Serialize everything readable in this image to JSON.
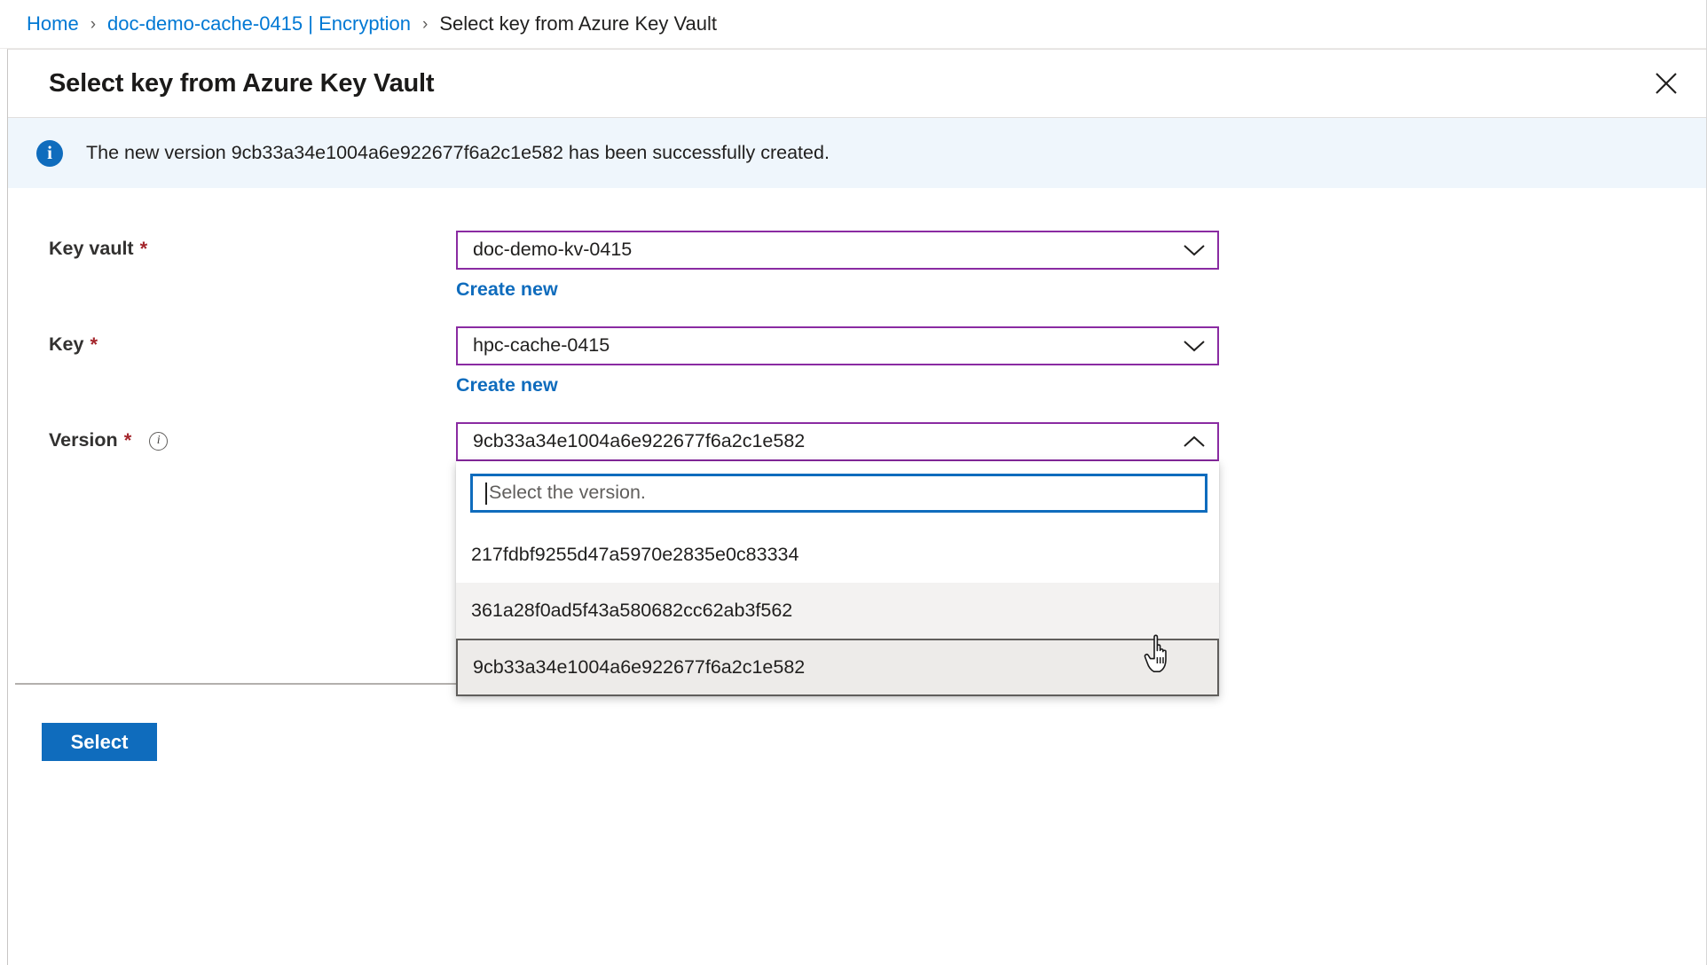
{
  "breadcrumb": {
    "items": [
      {
        "label": "Home",
        "current": false
      },
      {
        "label": "doc-demo-cache-0415 | Encryption",
        "current": false
      },
      {
        "label": "Select key from Azure Key Vault",
        "current": true
      }
    ],
    "separator": "›"
  },
  "blade": {
    "title": "Select key from Azure Key Vault",
    "close_label": "×"
  },
  "banner": {
    "icon": "info-icon",
    "glyph": "i",
    "text": "The new version 9cb33a34e1004a6e922677f6a2c1e582 has been successfully created.",
    "background": "#eff6fc",
    "icon_color": "#0f6cbd"
  },
  "form": {
    "key_vault": {
      "label": "Key vault",
      "required_marker": "*",
      "value": "doc-demo-kv-0415",
      "create_new_label": "Create new",
      "expanded": false
    },
    "key": {
      "label": "Key",
      "required_marker": "*",
      "value": "hpc-cache-0415",
      "create_new_label": "Create new",
      "expanded": false
    },
    "version": {
      "label": "Version",
      "required_marker": "*",
      "info_glyph": "i",
      "value": "9cb33a34e1004a6e922677f6a2c1e582",
      "expanded": true,
      "search_placeholder": "Select the version.",
      "options": [
        {
          "label": "217fdbf9255d47a5970e2835e0c83334",
          "state": "normal"
        },
        {
          "label": "361a28f0ad5f43a580682cc62ab3f562",
          "state": "hovered"
        },
        {
          "label": "9cb33a34e1004a6e922677f6a2c1e582",
          "state": "selected"
        }
      ]
    }
  },
  "footer": {
    "select_label": "Select",
    "accent_color": "#0f6cbd"
  },
  "colors": {
    "link": "#0078d4",
    "required": "#a4262c",
    "combo_border": "#8a2ba2",
    "focus_border": "#0f6cbd",
    "selected_row": "#edebe9",
    "hover_row": "#f3f2f1"
  }
}
